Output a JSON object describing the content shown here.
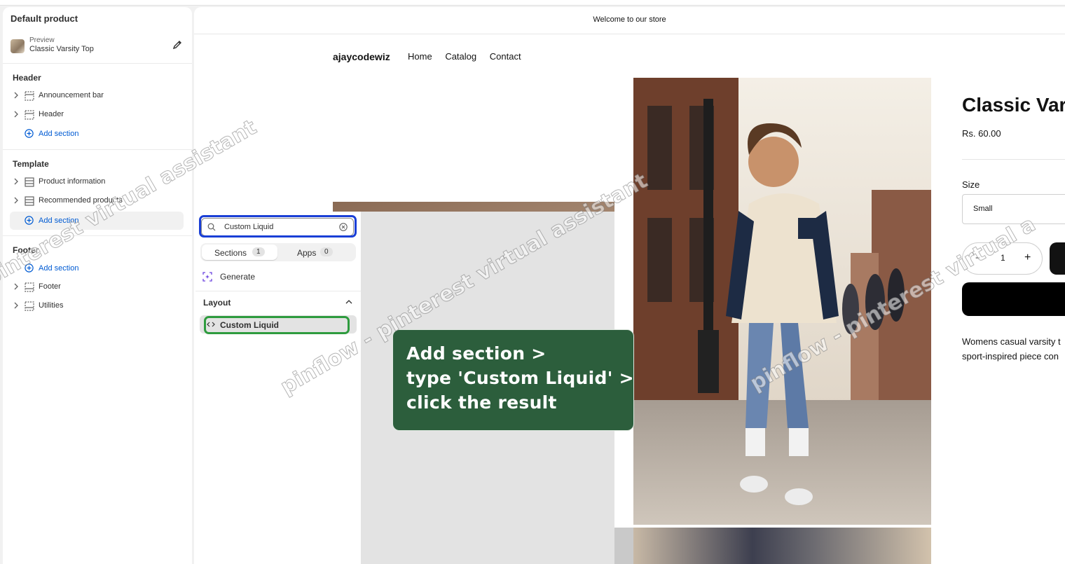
{
  "sidebar": {
    "title": "Default product",
    "preview_label": "Preview",
    "preview_name": "Classic Varsity Top",
    "header_group": "Header",
    "header_items": [
      "Announcement bar",
      "Header"
    ],
    "add_section": "Add section",
    "template_group": "Template",
    "template_items": [
      "Product information",
      "Recommended products"
    ],
    "footer_group": "Footer",
    "footer_items": [
      "Footer",
      "Utilities"
    ]
  },
  "store": {
    "announcement": "Welcome to our store",
    "logo": "ajaycodewiz",
    "nav": [
      "Home",
      "Catalog",
      "Contact"
    ],
    "product_title": "Classic Var",
    "price": "Rs. 60.00",
    "size_label": "Size",
    "size_value": "Small",
    "qty_minus": "−",
    "qty_value": "1",
    "qty_plus": "+",
    "description": [
      "Womens casual varsity t",
      "sport-inspired piece con"
    ]
  },
  "picker": {
    "search_value": "Custom Liquid",
    "tab_sections": "Sections",
    "tab_sections_count": "1",
    "tab_apps": "Apps",
    "tab_apps_count": "0",
    "generate": "Generate",
    "layout_group": "Layout",
    "result": "Custom Liquid"
  },
  "callout": {
    "line1": "Add section >",
    "line2": "type 'Custom Liquid' >",
    "line3": "click the result"
  },
  "watermarks": [
    "pinterest virtual assistant",
    "pinflow - pinterest virtual assistant",
    "pinflow - pinterest virtual a"
  ],
  "colors": {
    "accent_blue": "#005bd3",
    "highlight_blue": "#1a3fd6",
    "highlight_green": "#2e9b3e",
    "callout_bg": "#2c5e3c"
  }
}
